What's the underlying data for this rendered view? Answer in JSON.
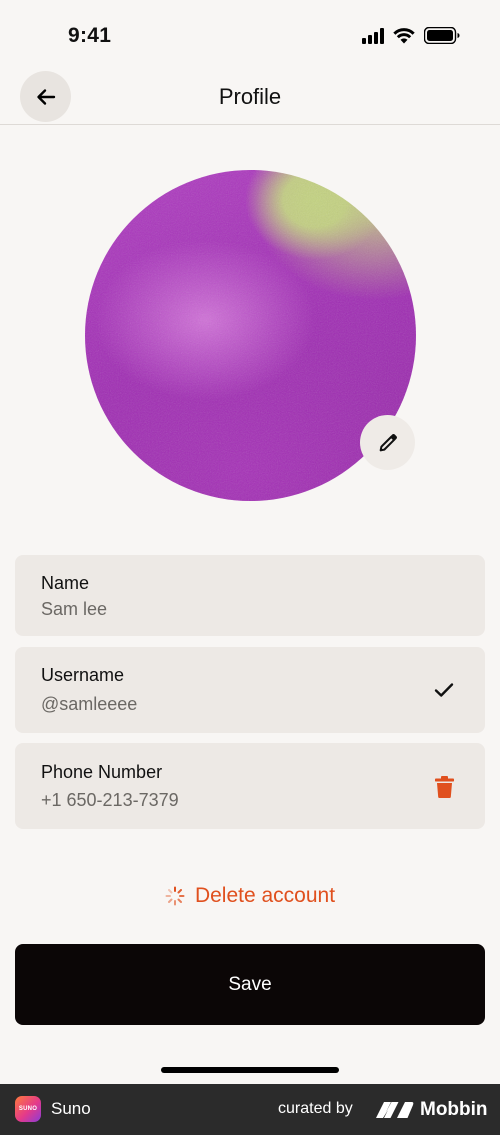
{
  "status_bar": {
    "time": "9:41"
  },
  "header": {
    "title": "Profile",
    "back_icon": "arrow-left-icon"
  },
  "avatar": {
    "edit_icon": "pencil-icon",
    "colors": [
      "#a630b8",
      "#d070d8",
      "#c4d480"
    ]
  },
  "fields": [
    {
      "label": "Name",
      "value": "Sam lee"
    },
    {
      "label": "Username",
      "value": "@samleeee",
      "action_icon": "checkmark-icon"
    },
    {
      "label": "Phone Number",
      "value": "+1 650-213-7379",
      "action_icon": "trash-icon"
    }
  ],
  "delete_account": {
    "label": "Delete account",
    "icon": "spinner-icon",
    "color": "#e0501e"
  },
  "save": {
    "label": "Save"
  },
  "footer": {
    "app_name": "Suno",
    "app_icon_text": "SUNO",
    "curated_by": "curated by",
    "brand": "Mobbin"
  }
}
